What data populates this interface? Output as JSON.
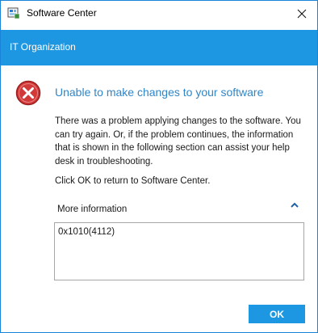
{
  "window": {
    "title": "Software Center",
    "app_icon": "software-center-icon",
    "close_icon": "close-icon"
  },
  "banner": {
    "organization": "IT Organization",
    "color": "#1e97e2"
  },
  "error": {
    "icon": "error-icon",
    "heading": "Unable to make changes to your software",
    "message": "There was a problem applying changes to the software. You can try again. Or, if the problem continues, the information that is shown in the following section can assist your help desk in troubleshooting.",
    "return_text": "Click OK to return to Software Center."
  },
  "more_info": {
    "label": "More information",
    "toggle_icon": "chevron-up-icon",
    "details": "0x1010(4112)"
  },
  "buttons": {
    "ok_label": "OK"
  },
  "colors": {
    "accent": "#1e97e2",
    "heading": "#2f86c9",
    "error_red": "#d23a3a"
  }
}
